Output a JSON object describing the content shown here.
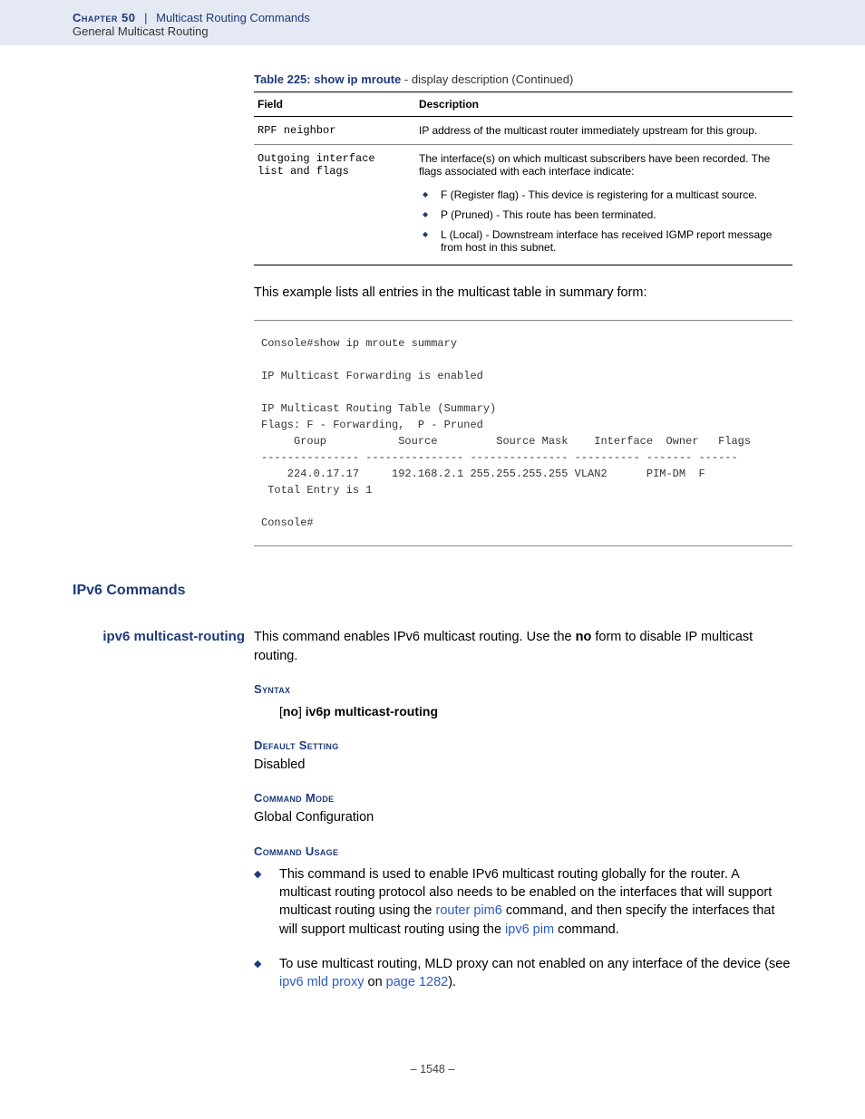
{
  "header": {
    "chapter": "Chapter 50",
    "sep": "|",
    "title": "Multicast Routing Commands",
    "subtitle": "General Multicast Routing"
  },
  "table": {
    "caption_bold": "Table 225: show ip mroute",
    "caption_rest": " - display description (Continued)",
    "col1": "Field",
    "col2": "Description",
    "rows": [
      {
        "field": "RPF neighbor",
        "desc": "IP address of the multicast router immediately upstream for this group."
      },
      {
        "field": "Outgoing interface\nlist and flags",
        "desc": "The interface(s) on which multicast subscribers have been recorded. The flags associated with each interface indicate:",
        "flags": [
          "F (Register flag) - This device is registering for a multicast source.",
          "P (Pruned) - This route has been terminated.",
          "L (Local) - Downstream interface has received IGMP report message from host in this subnet."
        ]
      }
    ]
  },
  "summary_text": "This example lists all entries in the multicast table in summary form:",
  "console": "Console#show ip mroute summary\n\nIP Multicast Forwarding is enabled\n\nIP Multicast Routing Table (Summary)\nFlags: F - Forwarding,  P - Pruned\n     Group           Source         Source Mask    Interface  Owner   Flags\n--------------- --------------- --------------- ---------- ------- ------\n    224.0.17.17     192.168.2.1 255.255.255.255 VLAN2      PIM-DM  F\n Total Entry is 1\n\nConsole#",
  "ipv6_heading": "IPv6 Commands",
  "cmd": {
    "name": "ipv6 multicast-routing",
    "desc_pre": "This command enables IPv6 multicast routing. Use the ",
    "desc_bold": "no",
    "desc_post": " form to disable IP multicast routing.",
    "syntax_label": "Syntax",
    "syntax_br_open": "[",
    "syntax_no": "no",
    "syntax_br_close": "] ",
    "syntax_cmd": "iv6p multicast-routing",
    "default_label": "Default Setting",
    "default_val": "Disabled",
    "mode_label": "Command Mode",
    "mode_val": "Global Configuration",
    "usage_label": "Command Usage",
    "usage": [
      {
        "text_1": "This command is used to enable IPv6 multicast routing globally for the router. A multicast routing protocol also needs to be enabled on the interfaces that will support multicast routing using the ",
        "link_1": "router pim6",
        "text_2": " command, and then specify the interfaces that will support multicast routing using the ",
        "link_2": "ipv6 pim",
        "text_3": " command."
      },
      {
        "text_1": "To use multicast routing, MLD proxy can not enabled on any interface of the device (see ",
        "link_1": "ipv6 mld proxy",
        "text_2": " on ",
        "link_2": "page 1282",
        "text_3": ")."
      }
    ]
  },
  "page_number": "– 1548 –"
}
